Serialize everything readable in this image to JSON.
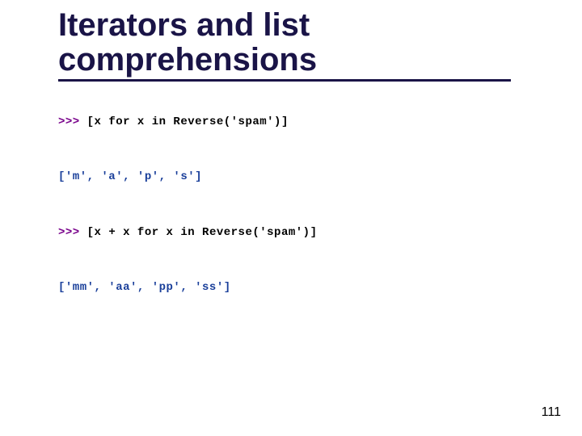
{
  "title": "Iterators and list comprehensions",
  "lines": [
    {
      "prompt": ">>>",
      "code": " [x for x in Reverse('spam')]"
    },
    {
      "output": "['m', 'a', 'p', 's']"
    },
    {
      "prompt": ">>>",
      "code": " [x + x for x in Reverse('spam')]"
    },
    {
      "output": "['mm', 'aa', 'pp', 'ss']"
    }
  ],
  "page_number": "111"
}
